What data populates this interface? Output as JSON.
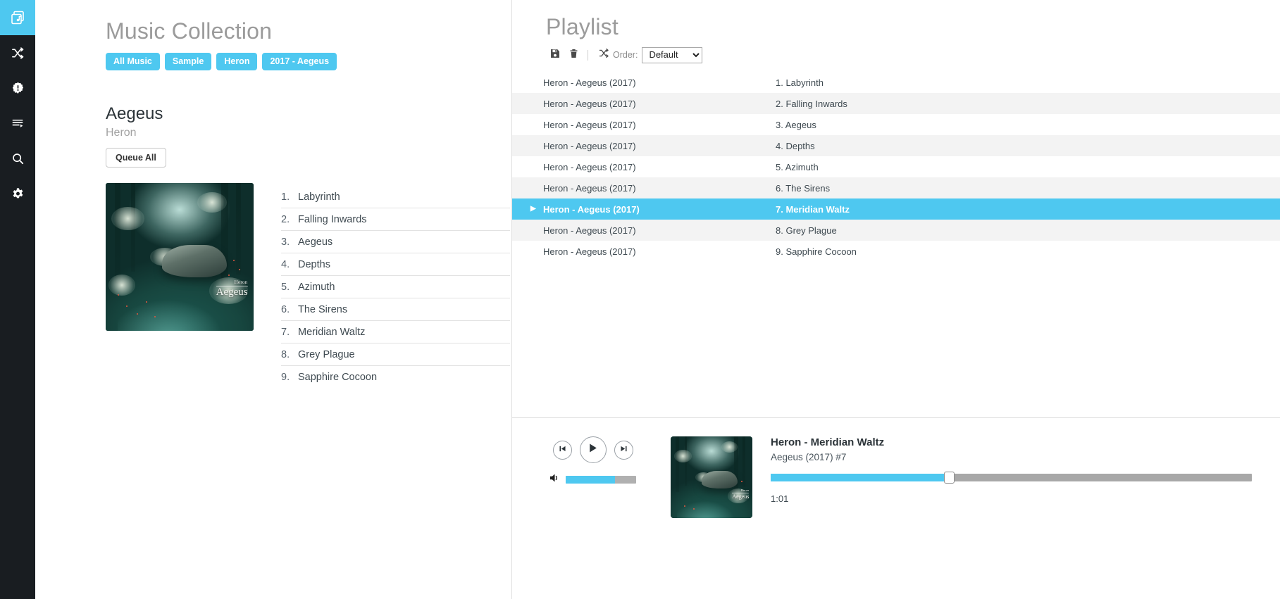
{
  "sidebar": {
    "items": [
      {
        "name": "library",
        "icon": "albums-icon",
        "active": true
      },
      {
        "name": "shuffle",
        "icon": "shuffle-icon",
        "active": false
      },
      {
        "name": "alerts",
        "icon": "alert-gear-icon",
        "active": false
      },
      {
        "name": "queue",
        "icon": "playlist-add-icon",
        "active": false
      },
      {
        "name": "search",
        "icon": "search-icon",
        "active": false
      },
      {
        "name": "settings",
        "icon": "gear-icon",
        "active": false
      }
    ]
  },
  "collection": {
    "title": "Music Collection",
    "breadcrumbs": [
      "All Music",
      "Sample",
      "Heron",
      "2017 - Aegeus"
    ]
  },
  "album": {
    "name": "Aegeus",
    "artist": "Heron",
    "queue_all_label": "Queue All",
    "cover_artist_text": "Heron",
    "cover_title_text": "Aegeus",
    "tracks": [
      {
        "num": "1.",
        "title": "Labyrinth"
      },
      {
        "num": "2.",
        "title": "Falling Inwards"
      },
      {
        "num": "3.",
        "title": "Aegeus"
      },
      {
        "num": "4.",
        "title": "Depths"
      },
      {
        "num": "5.",
        "title": "Azimuth"
      },
      {
        "num": "6.",
        "title": "The Sirens"
      },
      {
        "num": "7.",
        "title": "Meridian Waltz"
      },
      {
        "num": "8.",
        "title": "Grey Plague"
      },
      {
        "num": "9.",
        "title": "Sapphire Cocoon"
      }
    ]
  },
  "playlist": {
    "title": "Playlist",
    "order_label": "Order:",
    "order_value": "Default",
    "order_options": [
      "Default"
    ],
    "save_icon": "save-icon",
    "delete_icon": "trash-icon",
    "shuffle_icon": "shuffle-icon",
    "rows": [
      {
        "album": "Heron - Aegeus (2017)",
        "track": "1. Labyrinth",
        "selected": false
      },
      {
        "album": "Heron - Aegeus (2017)",
        "track": "2. Falling Inwards",
        "selected": false
      },
      {
        "album": "Heron - Aegeus (2017)",
        "track": "3. Aegeus",
        "selected": false
      },
      {
        "album": "Heron - Aegeus (2017)",
        "track": "4. Depths",
        "selected": false
      },
      {
        "album": "Heron - Aegeus (2017)",
        "track": "5. Azimuth",
        "selected": false
      },
      {
        "album": "Heron - Aegeus (2017)",
        "track": "6. The Sirens",
        "selected": false
      },
      {
        "album": "Heron - Aegeus (2017)",
        "track": "7. Meridian Waltz",
        "selected": true
      },
      {
        "album": "Heron - Aegeus (2017)",
        "track": "8. Grey Plague",
        "selected": false
      },
      {
        "album": "Heron - Aegeus (2017)",
        "track": "9. Sapphire Cocoon",
        "selected": false
      }
    ]
  },
  "player": {
    "now_title": "Heron - Meridian Waltz",
    "now_subtitle": "Aegeus (2017) #7",
    "elapsed": "1:01",
    "progress_percent": 37,
    "volume_percent": 70,
    "prev_icon": "skip-previous-icon",
    "play_icon": "play-icon",
    "next_icon": "skip-next-icon",
    "volume_icon": "volume-icon",
    "cover_artist_text": "Heron",
    "cover_title_text": "Aegeus"
  },
  "colors": {
    "accent": "#4ec8f0",
    "sidebar_bg": "#191d21",
    "row_alt": "#f3f3f3",
    "muted_text": "#9b9b9b"
  }
}
